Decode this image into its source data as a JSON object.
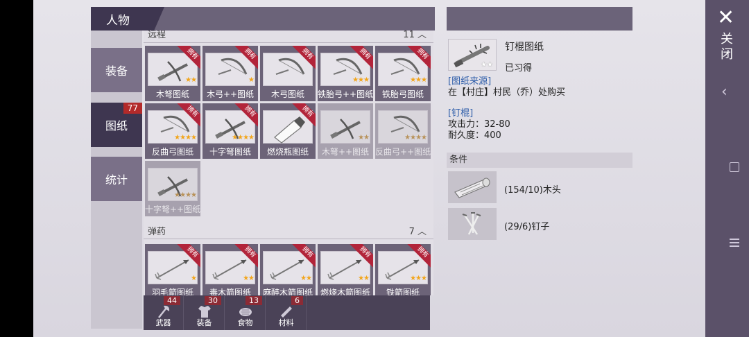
{
  "header": {
    "title": "人物"
  },
  "sidebar": {
    "items": [
      {
        "label": "装备",
        "badge": ""
      },
      {
        "label": "图纸",
        "badge": "77"
      },
      {
        "label": "统计",
        "badge": ""
      }
    ]
  },
  "sections": [
    {
      "name": "远程",
      "count": "11"
    },
    {
      "name": "弹药",
      "count": "7"
    }
  ],
  "ranged": [
    {
      "label": "木弩图纸",
      "owned": "拥有",
      "stars": "★★",
      "art": "crossbow"
    },
    {
      "label": "木弓++图纸",
      "owned": "拥有",
      "stars": "★",
      "art": "bow"
    },
    {
      "label": "木弓图纸",
      "owned": "拥有",
      "stars": "",
      "art": "bow"
    },
    {
      "label": "铁胎弓++图纸",
      "owned": "拥有",
      "stars": "★★★",
      "art": "bow"
    },
    {
      "label": "铁胎弓图纸",
      "owned": "拥有",
      "stars": "★★★",
      "art": "bow"
    },
    {
      "label": "反曲弓图纸",
      "owned": "拥有",
      "stars": "★★★★",
      "art": "bow"
    },
    {
      "label": "十字弩图纸",
      "owned": "拥有",
      "stars": "★★★★",
      "art": "crossbow"
    },
    {
      "label": "燃烧瓶图纸",
      "owned": "拥有",
      "stars": "",
      "art": "bottle"
    },
    {
      "label": "木弩++图纸",
      "owned": "",
      "stars": "★★",
      "art": "crossbow"
    },
    {
      "label": "反曲弓++图纸",
      "owned": "",
      "stars": "★★★★",
      "art": "bow"
    },
    {
      "label": "十字弩++图纸",
      "owned": "",
      "stars": "★★★★",
      "art": "crossbow"
    }
  ],
  "ammo": [
    {
      "label": "羽毛箭图纸",
      "owned": "拥有",
      "stars": "★",
      "art": "arrow"
    },
    {
      "label": "毒木箭图纸",
      "owned": "拥有",
      "stars": "★★",
      "art": "arrow"
    },
    {
      "label": "麻醉木箭图纸",
      "owned": "拥有",
      "stars": "★★",
      "art": "arrow"
    },
    {
      "label": "燃烧木箭图纸",
      "owned": "拥有",
      "stars": "★★",
      "art": "arrow"
    },
    {
      "label": "铁箭图纸",
      "owned": "拥有",
      "stars": "★★★",
      "art": "arrow"
    }
  ],
  "bottom_tabs": [
    {
      "label": "武器",
      "count": "44",
      "icon": "axe-icon"
    },
    {
      "label": "装备",
      "count": "30",
      "icon": "shirt-icon"
    },
    {
      "label": "食物",
      "count": "13",
      "icon": "meat-icon"
    },
    {
      "label": "材料",
      "count": "6",
      "icon": "plank-icon"
    }
  ],
  "detail": {
    "name": "钉棍图纸",
    "stars": "★★",
    "status": "已习得",
    "source_heading": "[图纸来源]",
    "source_text": "在【村庄】村民（乔）处购买",
    "item_heading": "[钉棍]",
    "attack": "攻击力：32-80",
    "durability": "耐久度：400",
    "conditions_label": "条件",
    "materials": [
      {
        "text": "(154/10)木头",
        "icon": "wood-icon"
      },
      {
        "text": "(29/6)钉子",
        "icon": "nails-icon"
      }
    ]
  },
  "right_bar": {
    "close_label": "关闭"
  },
  "colors": {
    "panel_dark": "#3e3650",
    "badge_red": "#b32a2a",
    "ribbon_red": "#b2243a",
    "star_gold": "#f2a51a",
    "link_blue": "#2a5aa8"
  }
}
